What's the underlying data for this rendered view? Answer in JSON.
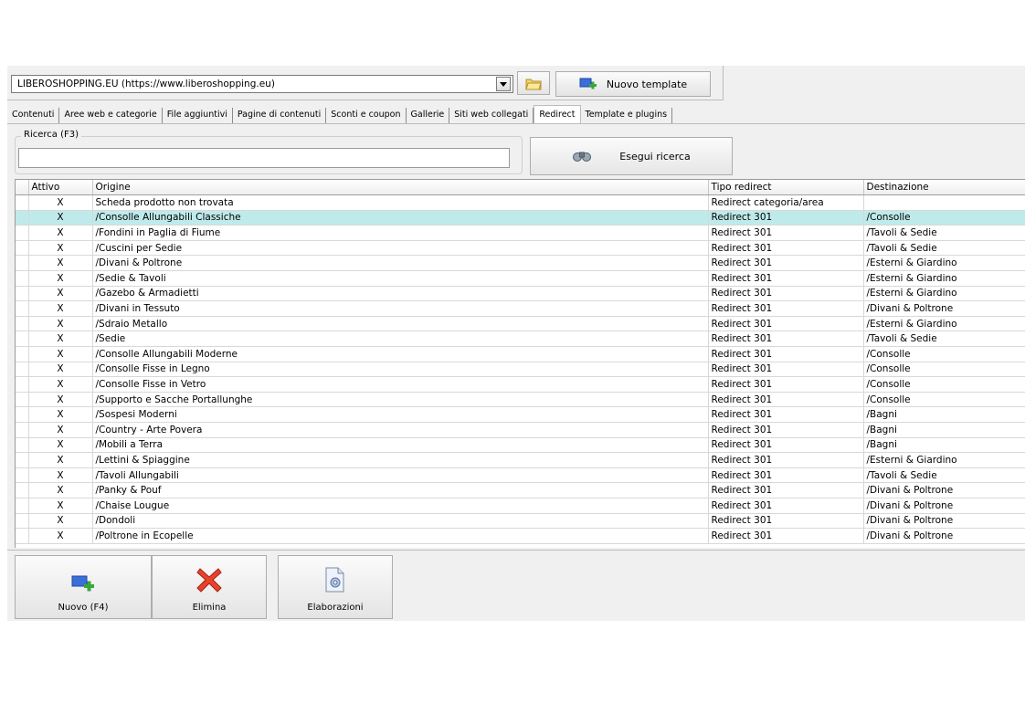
{
  "site_selector": {
    "value": "LIBEROSHOPPING.EU (https://www.liberoshopping.eu)"
  },
  "toolbar": {
    "template_label": "Nuovo template"
  },
  "tabs": [
    {
      "label": "Contenuti"
    },
    {
      "label": "Aree web e categorie"
    },
    {
      "label": "File aggiuntivi"
    },
    {
      "label": "Pagine di contenuti"
    },
    {
      "label": "Sconti e coupon"
    },
    {
      "label": "Gallerie"
    },
    {
      "label": "Siti web collegati"
    },
    {
      "label": "Redirect",
      "active": true
    },
    {
      "label": "Template e plugins"
    }
  ],
  "search": {
    "legend": "Ricerca (F3)",
    "value": "",
    "button_label": "Esegui ricerca"
  },
  "table": {
    "columns": [
      "Attivo",
      "Origine",
      "Tipo redirect",
      "Destinazione"
    ],
    "selected_row": 1,
    "rows": [
      [
        "X",
        "Scheda prodotto non trovata",
        "Redirect categoria/area",
        ""
      ],
      [
        "X",
        "/Consolle Allungabili Classiche",
        "Redirect 301",
        "/Consolle"
      ],
      [
        "X",
        "/Fondini in Paglia di Fiume",
        "Redirect 301",
        "/Tavoli & Sedie"
      ],
      [
        "X",
        "/Cuscini per Sedie",
        "Redirect 301",
        "/Tavoli & Sedie"
      ],
      [
        "X",
        "/Divani & Poltrone",
        "Redirect 301",
        "/Esterni & Giardino"
      ],
      [
        "X",
        "/Sedie & Tavoli",
        "Redirect 301",
        "/Esterni & Giardino"
      ],
      [
        "X",
        "/Gazebo & Armadietti",
        "Redirect 301",
        "/Esterni & Giardino"
      ],
      [
        "X",
        "/Divani in Tessuto",
        "Redirect 301",
        "/Divani & Poltrone"
      ],
      [
        "X",
        "/Sdraio Metallo",
        "Redirect 301",
        "/Esterni & Giardino"
      ],
      [
        "X",
        "/Sedie",
        "Redirect 301",
        "/Tavoli & Sedie"
      ],
      [
        "X",
        "/Consolle Allungabili Moderne",
        "Redirect 301",
        "/Consolle"
      ],
      [
        "X",
        "/Consolle Fisse in Legno",
        "Redirect 301",
        "/Consolle"
      ],
      [
        "X",
        "/Consolle Fisse in Vetro",
        "Redirect 301",
        "/Consolle"
      ],
      [
        "X",
        "/Supporto e Sacche Portallunghe",
        "Redirect 301",
        "/Consolle"
      ],
      [
        "X",
        "/Sospesi Moderni",
        "Redirect 301",
        "/Bagni"
      ],
      [
        "X",
        "/Country - Arte Povera",
        "Redirect 301",
        "/Bagni"
      ],
      [
        "X",
        "/Mobili a Terra",
        "Redirect 301",
        "/Bagni"
      ],
      [
        "X",
        "/Lettini & Spiaggine",
        "Redirect 301",
        "/Esterni & Giardino"
      ],
      [
        "X",
        "/Tavoli Allungabili",
        "Redirect 301",
        "/Tavoli & Sedie"
      ],
      [
        "X",
        "/Panky & Pouf",
        "Redirect 301",
        "/Divani & Poltrone"
      ],
      [
        "X",
        "/Chaise Lougue",
        "Redirect 301",
        "/Divani & Poltrone"
      ],
      [
        "X",
        "/Dondoli",
        "Redirect 301",
        "/Divani & Poltrone"
      ],
      [
        "X",
        "/Poltrone in Ecopelle",
        "Redirect 301",
        "/Divani & Poltrone"
      ]
    ]
  },
  "actions": {
    "new_label": "Nuovo (F4)",
    "delete_label": "Elimina",
    "process_label": "Elaborazioni"
  },
  "colors": {
    "selected_row": "#bfeaeb",
    "delete_icon": "#e8412c",
    "new_icon_blue": "#3a6fd8",
    "new_icon_green": "#3aa63a"
  }
}
